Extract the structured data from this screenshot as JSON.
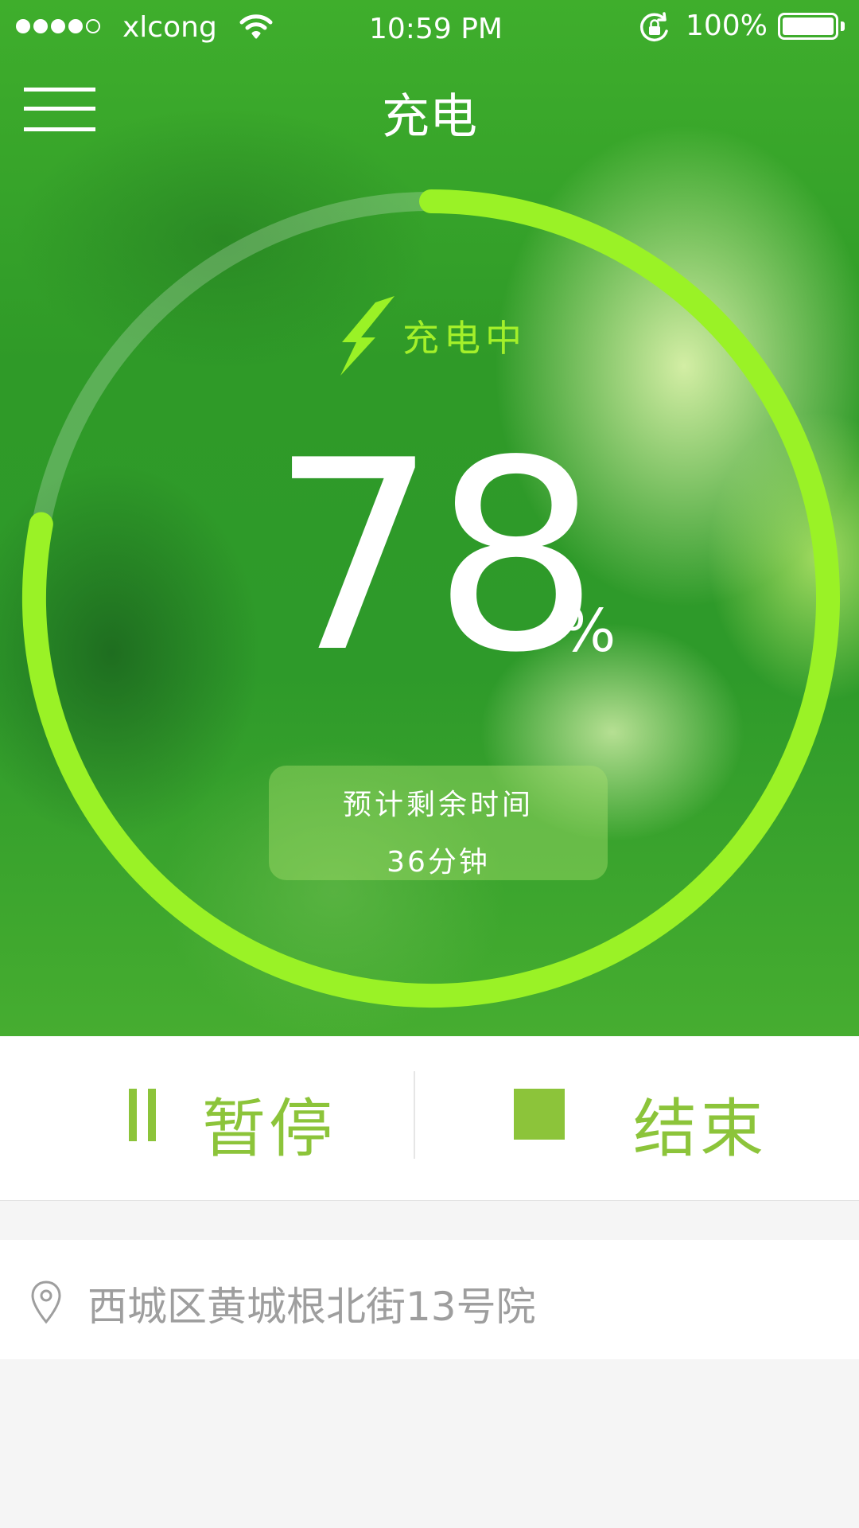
{
  "status_bar": {
    "signal_dots": 5,
    "signal_filled": 4,
    "carrier": "xlcong",
    "time": "10:59 PM",
    "battery_percent": "100%",
    "icons": [
      "wifi-icon",
      "rotation-lock-icon",
      "battery-icon"
    ]
  },
  "header": {
    "title": "充电",
    "menu_icon": "hamburger-menu-icon"
  },
  "charging": {
    "status_text": "充电中",
    "status_icon": "lightning-bolt-icon",
    "percent_value": "78",
    "percent_unit": "%",
    "progress": 0.78,
    "eta_label": "预计剩余时间",
    "eta_value": "36分钟"
  },
  "controls": {
    "pause_label": "暂停",
    "stop_label": "结束",
    "pause_icon": "pause-icon",
    "stop_icon": "stop-icon"
  },
  "location": {
    "icon": "location-pin-icon",
    "address": "西城区黄城根北街13号院"
  },
  "colors": {
    "accent": "#8cc43a",
    "ring_progress": "#9af226",
    "ring_track": "rgba(255,255,255,0.22)",
    "status_text": "#a4f02a"
  }
}
